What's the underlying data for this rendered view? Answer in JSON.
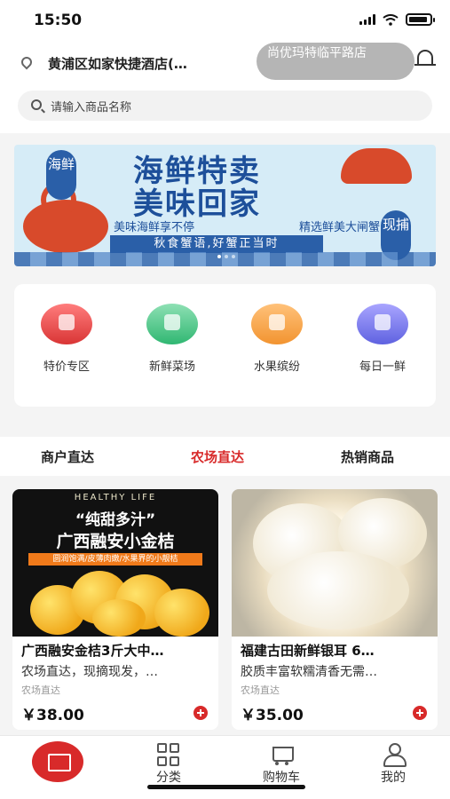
{
  "status_bar": {
    "time": "15:50"
  },
  "header": {
    "location": "黄浦区如家快捷酒店(…",
    "store_name": "尚优玛特临平路店",
    "search_placeholder": "请输入商品名称"
  },
  "banner": {
    "side_left": "海鲜",
    "title_line1": "海鲜特卖",
    "title_line2": "美味回家",
    "subtitle_left": "美味海鲜享不停",
    "subtitle_right": "精选鲜美大闸蟹",
    "ribbon": "秋食蟹语,好蟹正当时",
    "side_right": "现捕"
  },
  "categories": [
    {
      "label": "特价专区",
      "icon": "sale-icon"
    },
    {
      "label": "新鲜菜场",
      "icon": "vegetable-icon"
    },
    {
      "label": "水果缤纷",
      "icon": "fruit-icon"
    },
    {
      "label": "每日一鲜",
      "icon": "seafood-icon"
    }
  ],
  "tabs": [
    {
      "label": "商户直达",
      "active": false
    },
    {
      "label": "农场直达",
      "active": true
    },
    {
      "label": "热销商品",
      "active": false
    }
  ],
  "products": [
    {
      "image_heading": "HEALTHY LIFE",
      "image_title1": "“纯甜多汁”",
      "image_title2": "广西融安小金桔",
      "image_band": "圆润饱满/皮薄肉嫩/水果界的小靓桔",
      "name": "广西融安金桔3斤大中…",
      "desc": "农场直达，现摘现发，…",
      "tag": "农场直达",
      "price": "￥38.00"
    },
    {
      "name": "福建古田新鲜银耳 6…",
      "desc": "胶质丰富软糯清香无需…",
      "tag": "农场直达",
      "price": "￥35.00"
    }
  ],
  "bottom_nav": [
    {
      "label": "",
      "icon": "home-basket-icon",
      "active": true
    },
    {
      "label": "分类",
      "icon": "category-grid-icon"
    },
    {
      "label": "购物车",
      "icon": "cart-icon"
    },
    {
      "label": "我的",
      "icon": "user-icon"
    }
  ],
  "colors": {
    "accent": "#d82a2a",
    "banner_blue": "#1d4f9a"
  }
}
